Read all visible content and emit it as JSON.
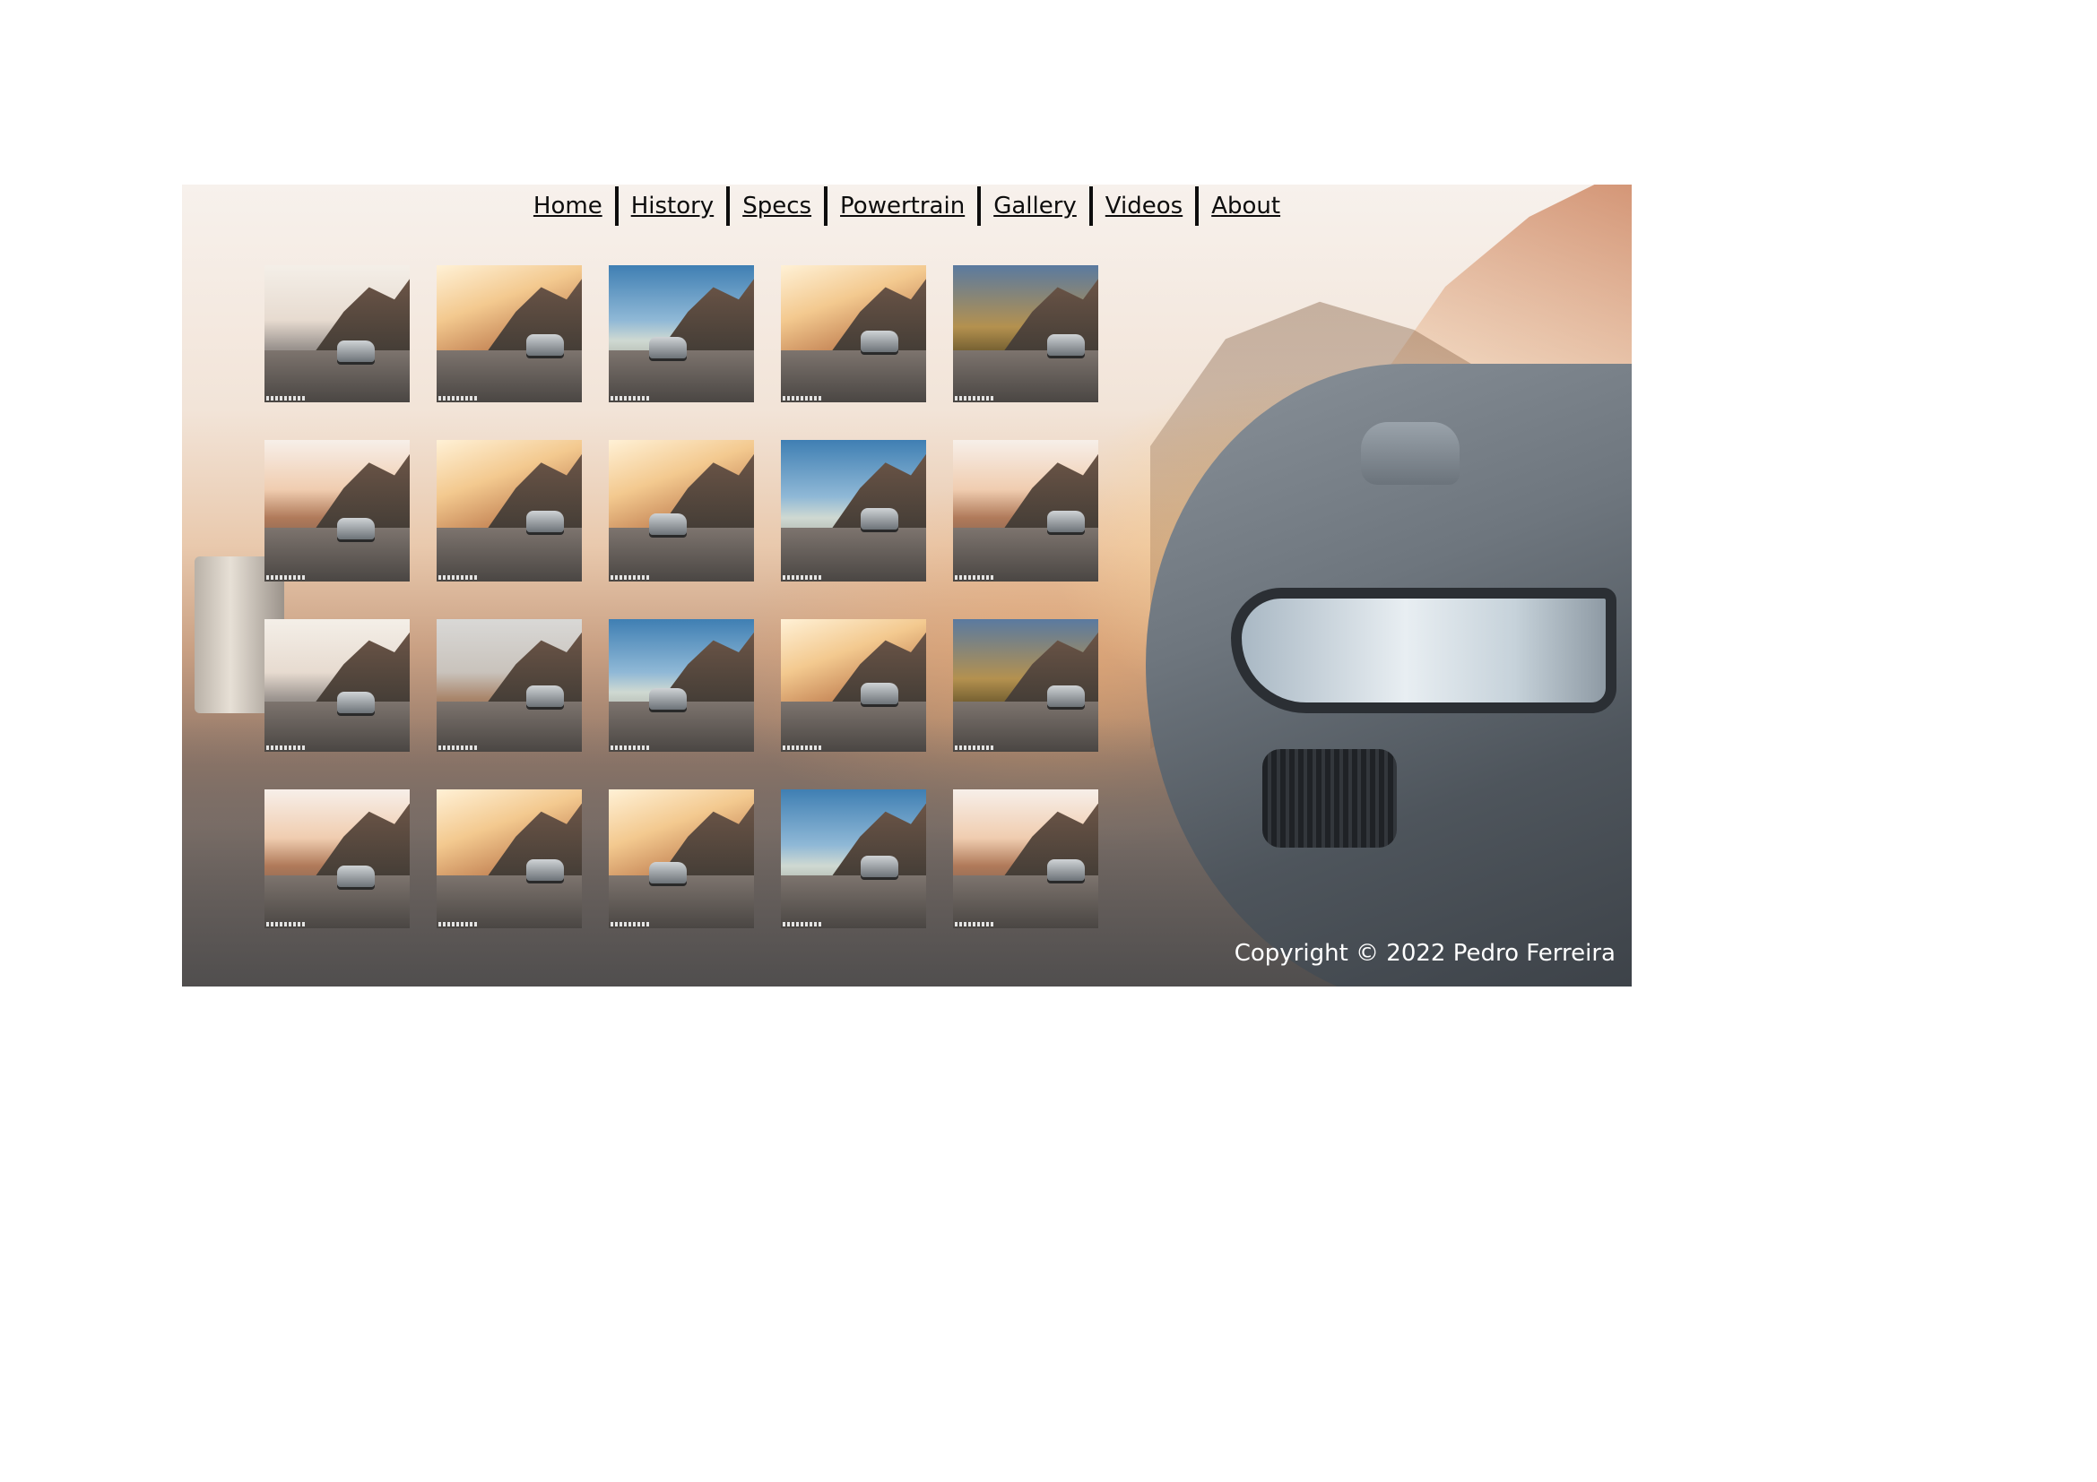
{
  "nav": {
    "items": [
      {
        "label": "Home"
      },
      {
        "label": "History"
      },
      {
        "label": "Specs"
      },
      {
        "label": "Powertrain"
      },
      {
        "label": "Gallery"
      },
      {
        "label": "Videos"
      },
      {
        "label": "About"
      }
    ]
  },
  "gallery": {
    "thumbnails": [
      {
        "style": "city"
      },
      {
        "style": "warm"
      },
      {
        "style": "blue"
      },
      {
        "style": "warm"
      },
      {
        "style": "forest"
      },
      {
        "style": "sunset"
      },
      {
        "style": "warm"
      },
      {
        "style": "warm"
      },
      {
        "style": "blue"
      },
      {
        "style": "sunset"
      },
      {
        "style": "city"
      },
      {
        "style": "pale"
      },
      {
        "style": "blue"
      },
      {
        "style": "warm"
      },
      {
        "style": "forest"
      },
      {
        "style": "sunset"
      },
      {
        "style": "warm"
      },
      {
        "style": "warm"
      },
      {
        "style": "blue"
      },
      {
        "style": "sunset"
      }
    ]
  },
  "footer": {
    "copyright": "Copyright © 2022 Pedro Ferreira"
  },
  "colors": {
    "nav_text": "#0d0d0d",
    "copyright_text": "#ffffff",
    "page_background": "#ffffff"
  }
}
